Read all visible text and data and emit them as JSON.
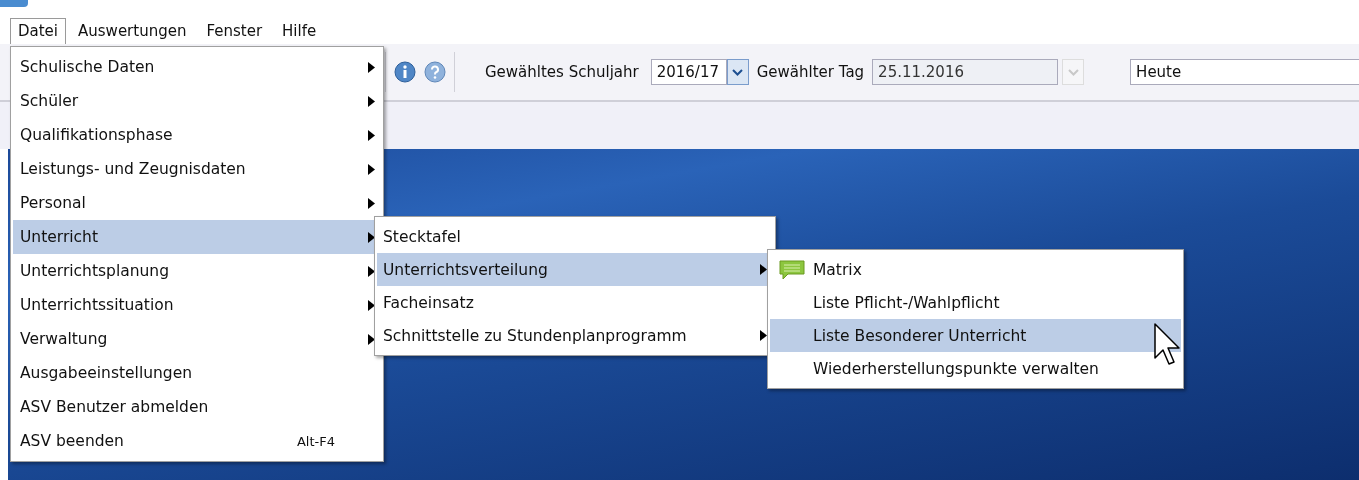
{
  "menubar": [
    {
      "label": "Datei",
      "selected": true
    },
    {
      "label": "Auswertungen",
      "selected": false
    },
    {
      "label": "Fenster",
      "selected": false
    },
    {
      "label": "Hilfe",
      "selected": false
    }
  ],
  "toolbar": {
    "school_year_label": "Gewähltes Schuljahr",
    "school_year": "2016/17",
    "day_label": "Gewählter Tag",
    "day": "25.11.2016",
    "day_disabled": true,
    "field_3": "Heute"
  },
  "menu": [
    {
      "label": "Schulische Daten",
      "has_submenu": true,
      "selected": false
    },
    {
      "label": "Schüler",
      "has_submenu": true,
      "selected": false
    },
    {
      "label": "Qualifikationsphase",
      "has_submenu": true,
      "selected": false
    },
    {
      "label": "Leistungs- und Zeugnisdaten",
      "has_submenu": true,
      "selected": false
    },
    {
      "label": "Personal",
      "has_submenu": true,
      "selected": false
    },
    {
      "label": "Unterricht",
      "has_submenu": true,
      "selected": true
    },
    {
      "label": "Unterrichtsplanung",
      "has_submenu": true,
      "selected": false
    },
    {
      "label": "Unterrichtssituation",
      "has_submenu": true,
      "selected": false
    },
    {
      "label": "Verwaltung",
      "has_submenu": true,
      "selected": false
    },
    {
      "label": "Ausgabeeinstellungen",
      "has_submenu": false,
      "selected": false
    },
    {
      "label": "ASV Benutzer abmelden",
      "has_submenu": false,
      "selected": false
    },
    {
      "label": "ASV beenden",
      "has_submenu": false,
      "selected": false,
      "shortcut": "Alt-F4"
    }
  ],
  "submenu": [
    {
      "label": "Stecktafel",
      "has_submenu": false,
      "selected": false
    },
    {
      "label": "Unterrichtsverteilung",
      "has_submenu": true,
      "selected": true
    },
    {
      "label": "Facheinsatz",
      "has_submenu": false,
      "selected": false
    },
    {
      "label": "Schnittstelle zu Stundenplanprogramm",
      "has_submenu": true,
      "selected": false
    }
  ],
  "submenu_2": [
    {
      "label": "Matrix",
      "has_submenu": false,
      "selected": false,
      "has_icon": true
    },
    {
      "label": "Liste Pflicht-/Wahlpflicht",
      "has_submenu": false,
      "selected": false,
      "has_icon": false
    },
    {
      "label": "Liste Besonderer Unterricht",
      "has_submenu": false,
      "selected": true,
      "has_icon": false
    },
    {
      "label": "Wiederherstellungspunkte verwalten",
      "has_submenu": false,
      "selected": false,
      "has_icon": false
    }
  ]
}
